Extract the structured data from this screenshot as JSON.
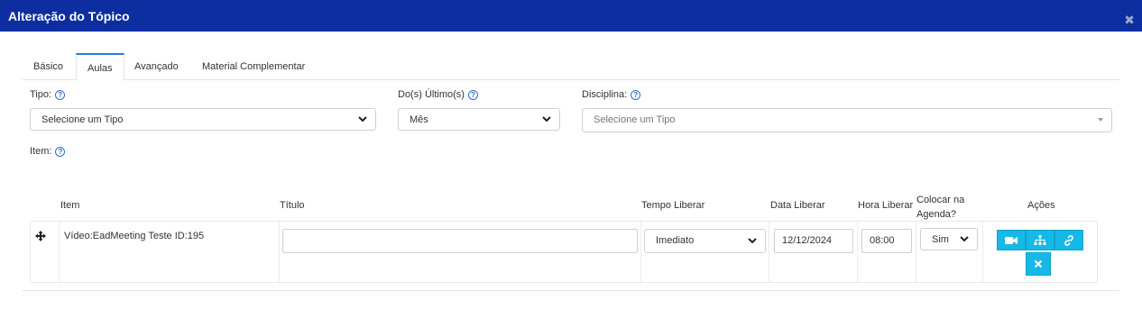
{
  "dialog": {
    "title": "Alteração do Tópico",
    "close_icon": "close-icon"
  },
  "tabs": [
    {
      "label": "Básico",
      "active": false
    },
    {
      "label": "Aulas",
      "active": true
    },
    {
      "label": "Avançado",
      "active": false
    },
    {
      "label": "Material Complementar",
      "active": false
    }
  ],
  "form": {
    "tipo_label": "Tipo:",
    "tipo_value": "Selecione um Tipo",
    "ultimos_label": "Do(s) Último(s)",
    "ultimos_value": "Mês",
    "disciplina_label": "Disciplina:",
    "disciplina_value": "Selecione um Tipo",
    "item_label": "Item:"
  },
  "table": {
    "headers": {
      "item": "Item",
      "titulo": "Título",
      "tempo_liberar": "Tempo Liberar",
      "data_liberar": "Data Liberar",
      "hora_liberar": "Hora Liberar",
      "colocar_agenda_1": "Colocar na",
      "colocar_agenda_2": "Agenda?",
      "acoes": "Ações"
    },
    "rows": [
      {
        "item": "Vídeo:EadMeeting Teste ID:195",
        "titulo": "",
        "tempo_liberar": "Imediato",
        "data_liberar": "12/12/2024",
        "hora_liberar": "08:00",
        "colocar_agenda": "Sim"
      }
    ]
  },
  "colors": {
    "header_bg": "#0c2ea0",
    "action_btn": "#16b9e6",
    "help_icon": "#2b6fd1"
  }
}
